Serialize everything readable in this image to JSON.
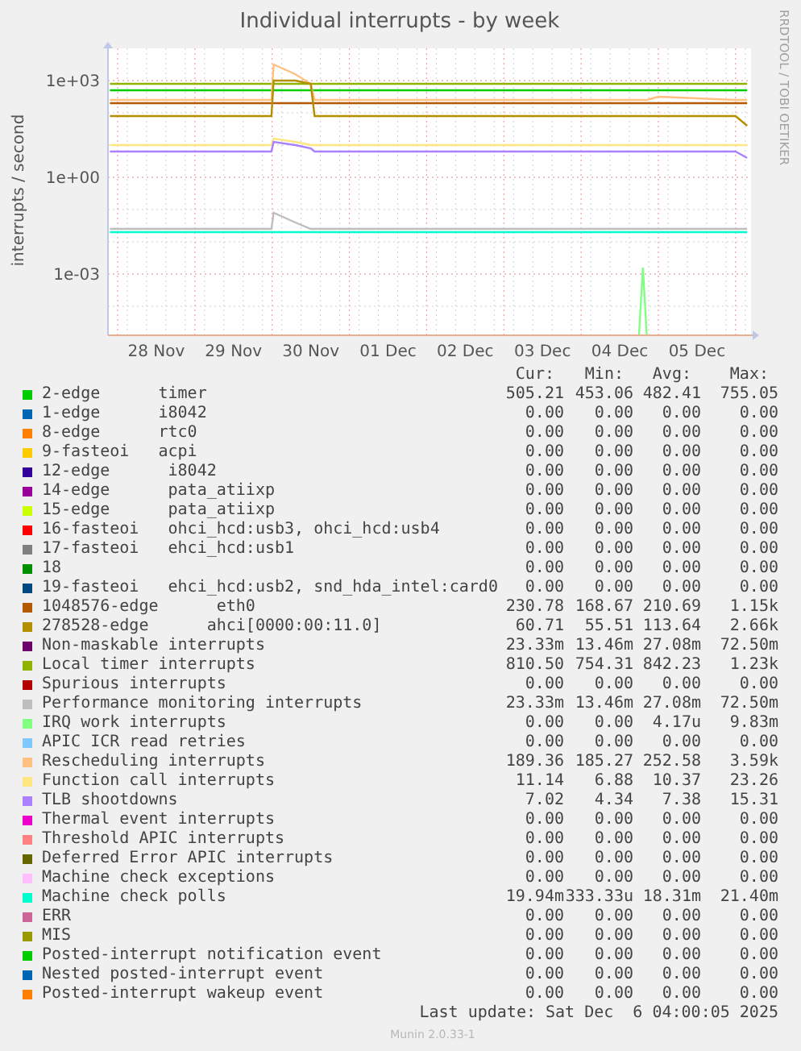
{
  "graph": {
    "title": "Individual interrupts - by week",
    "y_axis_label": "interrupts / second",
    "y_ticks": [
      "1e+03",
      "1e+00",
      "1e-03"
    ],
    "x_ticks": [
      "28 Nov",
      "29 Nov",
      "30 Nov",
      "01 Dec",
      "02 Dec",
      "03 Dec",
      "04 Dec",
      "05 Dec"
    ]
  },
  "watermark_text": "RRDTOOL / TOBI OETIKER",
  "legend": {
    "columns": [
      "Cur:",
      "Min:",
      "Avg:",
      "Max:"
    ],
    "items": [
      {
        "color": "#00cc00",
        "name": "2-edge      timer",
        "cur": "505.21",
        "min": "453.06",
        "avg": "482.41",
        "max": "755.05"
      },
      {
        "color": "#0066b3",
        "name": "1-edge      i8042",
        "cur": "0.00",
        "min": "0.00",
        "avg": "0.00",
        "max": "0.00"
      },
      {
        "color": "#ff8000",
        "name": "8-edge      rtc0",
        "cur": "0.00",
        "min": "0.00",
        "avg": "0.00",
        "max": "0.00"
      },
      {
        "color": "#ffcc00",
        "name": "9-fasteoi   acpi",
        "cur": "0.00",
        "min": "0.00",
        "avg": "0.00",
        "max": "0.00"
      },
      {
        "color": "#330099",
        "name": "12-edge      i8042",
        "cur": "0.00",
        "min": "0.00",
        "avg": "0.00",
        "max": "0.00"
      },
      {
        "color": "#990099",
        "name": "14-edge      pata_atiixp",
        "cur": "0.00",
        "min": "0.00",
        "avg": "0.00",
        "max": "0.00"
      },
      {
        "color": "#ccff00",
        "name": "15-edge      pata_atiixp",
        "cur": "0.00",
        "min": "0.00",
        "avg": "0.00",
        "max": "0.00"
      },
      {
        "color": "#ff0000",
        "name": "16-fasteoi   ohci_hcd:usb3, ohci_hcd:usb4",
        "cur": "0.00",
        "min": "0.00",
        "avg": "0.00",
        "max": "0.00"
      },
      {
        "color": "#808080",
        "name": "17-fasteoi   ehci_hcd:usb1",
        "cur": "0.00",
        "min": "0.00",
        "avg": "0.00",
        "max": "0.00"
      },
      {
        "color": "#008f00",
        "name": "18",
        "cur": "0.00",
        "min": "0.00",
        "avg": "0.00",
        "max": "0.00"
      },
      {
        "color": "#00487d",
        "name": "19-fasteoi   ehci_hcd:usb2, snd_hda_intel:card0",
        "cur": "0.00",
        "min": "0.00",
        "avg": "0.00",
        "max": "0.00"
      },
      {
        "color": "#b35a00",
        "name": "1048576-edge      eth0",
        "cur": "230.78",
        "min": "168.67",
        "avg": "210.69",
        "max": "1.15k"
      },
      {
        "color": "#b38f00",
        "name": "278528-edge      ahci[0000:00:11.0]",
        "cur": "60.71",
        "min": "55.51",
        "avg": "113.64",
        "max": "2.66k"
      },
      {
        "color": "#6b006b",
        "name": "Non-maskable interrupts",
        "cur": "23.33m",
        "min": "13.46m",
        "avg": "27.08m",
        "max": "72.50m"
      },
      {
        "color": "#8fb300",
        "name": "Local timer interrupts",
        "cur": "810.50",
        "min": "754.31",
        "avg": "842.23",
        "max": "1.23k"
      },
      {
        "color": "#b30000",
        "name": "Spurious interrupts",
        "cur": "0.00",
        "min": "0.00",
        "avg": "0.00",
        "max": "0.00"
      },
      {
        "color": "#bebebe",
        "name": "Performance monitoring interrupts",
        "cur": "23.33m",
        "min": "13.46m",
        "avg": "27.08m",
        "max": "72.50m"
      },
      {
        "color": "#80ff80",
        "name": "IRQ work interrupts",
        "cur": "0.00",
        "min": "0.00",
        "avg": "4.17u",
        "max": "9.83m"
      },
      {
        "color": "#80c9ff",
        "name": "APIC ICR read retries",
        "cur": "0.00",
        "min": "0.00",
        "avg": "0.00",
        "max": "0.00"
      },
      {
        "color": "#ffc080",
        "name": "Rescheduling interrupts",
        "cur": "189.36",
        "min": "185.27",
        "avg": "252.58",
        "max": "3.59k"
      },
      {
        "color": "#ffe680",
        "name": "Function call interrupts",
        "cur": "11.14",
        "min": "6.88",
        "avg": "10.37",
        "max": "23.26"
      },
      {
        "color": "#aa80ff",
        "name": "TLB shootdowns",
        "cur": "7.02",
        "min": "4.34",
        "avg": "7.38",
        "max": "15.31"
      },
      {
        "color": "#ee00cc",
        "name": "Thermal event interrupts",
        "cur": "0.00",
        "min": "0.00",
        "avg": "0.00",
        "max": "0.00"
      },
      {
        "color": "#ff8080",
        "name": "Threshold APIC interrupts",
        "cur": "0.00",
        "min": "0.00",
        "avg": "0.00",
        "max": "0.00"
      },
      {
        "color": "#666600",
        "name": "Deferred Error APIC interrupts",
        "cur": "0.00",
        "min": "0.00",
        "avg": "0.00",
        "max": "0.00"
      },
      {
        "color": "#ffbfff",
        "name": "Machine check exceptions",
        "cur": "0.00",
        "min": "0.00",
        "avg": "0.00",
        "max": "0.00"
      },
      {
        "color": "#00ffcc",
        "name": "Machine check polls",
        "cur": "19.94m",
        "min": "333.33u",
        "avg": "18.31m",
        "max": "21.40m"
      },
      {
        "color": "#cc6699",
        "name": "ERR",
        "cur": "0.00",
        "min": "0.00",
        "avg": "0.00",
        "max": "0.00"
      },
      {
        "color": "#999900",
        "name": "MIS",
        "cur": "0.00",
        "min": "0.00",
        "avg": "0.00",
        "max": "0.00"
      },
      {
        "color": "#00cc00",
        "name": "Posted-interrupt notification event",
        "cur": "0.00",
        "min": "0.00",
        "avg": "0.00",
        "max": "0.00"
      },
      {
        "color": "#0066b3",
        "name": "Nested posted-interrupt event",
        "cur": "0.00",
        "min": "0.00",
        "avg": "0.00",
        "max": "0.00"
      },
      {
        "color": "#ff8000",
        "name": "Posted-interrupt wakeup event",
        "cur": "0.00",
        "min": "0.00",
        "avg": "0.00",
        "max": "0.00"
      }
    ]
  },
  "last_update": "Last update: Sat Dec  6 04:00:05 2025",
  "version": "Munin 2.0.33-1"
}
